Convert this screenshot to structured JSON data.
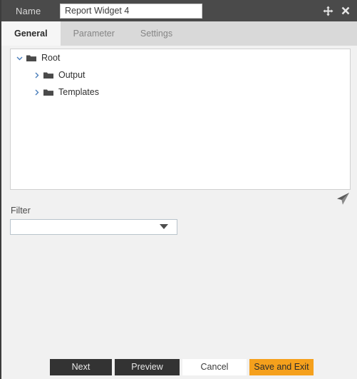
{
  "titlebar": {
    "name_label": "Name",
    "name_value": "Report Widget 4",
    "name_placeholder": "",
    "move_icon": "move-arrows-icon",
    "close_icon": "close-icon"
  },
  "tabs": [
    {
      "label": "General",
      "active": true
    },
    {
      "label": "Parameter",
      "active": false
    },
    {
      "label": "Settings",
      "active": false
    }
  ],
  "tree": {
    "nodes": [
      {
        "label": "Root",
        "level": 0,
        "expanded": true,
        "icon": "folder-icon"
      },
      {
        "label": "Output",
        "level": 1,
        "expanded": false,
        "icon": "folder-icon"
      },
      {
        "label": "Templates",
        "level": 1,
        "expanded": false,
        "icon": "folder-icon"
      }
    ]
  },
  "send": {
    "icon": "paper-plane-icon"
  },
  "filter": {
    "label": "Filter",
    "value": "",
    "placeholder": "",
    "options": []
  },
  "footer": {
    "next_label": "Next",
    "preview_label": "Preview",
    "cancel_label": "Cancel",
    "save_label": "Save and Exit"
  },
  "colors": {
    "titlebar": "#4a4a4a",
    "tabbar": "#d9d9d9",
    "body": "#f1f1f1",
    "accent": "#f5a01c",
    "button_dark": "#333333",
    "folder": "#4a4a4a"
  }
}
